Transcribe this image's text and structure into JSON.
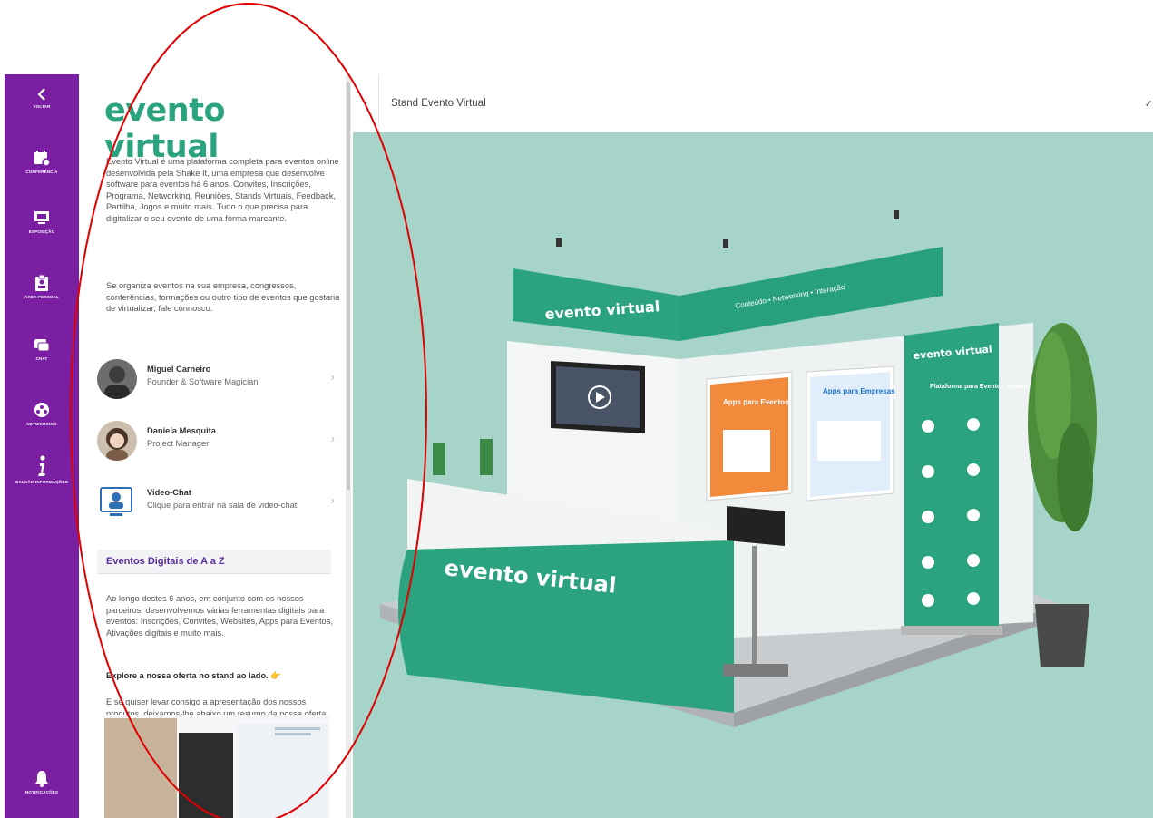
{
  "rail": {
    "items": [
      {
        "label": "VOLTAR",
        "icon": "chevron-left-icon"
      },
      {
        "label": "CONFERÊNCIA",
        "icon": "calendar-icon"
      },
      {
        "label": "EXPOSIÇÃO",
        "icon": "presentation-icon"
      },
      {
        "label": "ÁREA PESSOAL",
        "icon": "badge-icon"
      },
      {
        "label": "CHAT",
        "icon": "chat-icon"
      },
      {
        "label": "NETWORKING",
        "icon": "network-icon"
      },
      {
        "label": "BALCÃO INFORMAÇÕES",
        "icon": "info-icon"
      },
      {
        "label": "NOTIFICAÇÕES",
        "icon": "bell-icon"
      }
    ]
  },
  "panel": {
    "logo": "evento virtual",
    "intro": "Evento Virtual é uma plataforma completa para eventos online desenvolvida pela Shake It, uma empresa que desenvolve software para eventos há 6 anos. Convites, Inscrições, Programa, Networking, Reuniões, Stands Virtuais, Feedback, Partilha, Jogos e muito mais. Tudo o que precisa para digitalizar o seu evento de uma forma marcante.",
    "intro2": "Se organiza eventos na sua empresa, congressos, conferências, formações ou outro tipo de eventos que gostaria de virtualizar, fale connosco.",
    "contacts": [
      {
        "name": "Miguel Carneiro",
        "role": "Founder & Software Magician"
      },
      {
        "name": "Daniela Mesquita",
        "role": "Project Manager"
      },
      {
        "name": "Video-Chat",
        "role": "Clique para entrar na sala de video-chat"
      }
    ],
    "section_title": "Eventos Digitais de A a Z",
    "body": "Ao longo destes 6 anos, em conjunto com os nossos parceiros, desenvolvemos várias ferramentas digitais para eventos: Inscrições, Convites, Websites, Apps para Eventos, Ativações digitais e muito mais.",
    "explore": "Explore a nossa oferta no stand ao lado. 👉",
    "closing": "E se quiser levar consigo a apresentação dos nossos produtos, deixamos-lhe abaixo um resumo da nossa oferta, que pode enviar para o seu e-mail."
  },
  "stage": {
    "title": "Stand Evento Virtual",
    "back": "‹",
    "check": "✓",
    "booth_logo": "evento virtual",
    "booth_tagline": "Conteúdo • Networking • Interação",
    "poster1": "Apps para Eventos",
    "poster2": "Apps para Empresas",
    "banner_logo": "evento virtual",
    "banner_title": "Plataforma para Eventos Virtuais",
    "counter_logo": "evento virtual"
  },
  "colors": {
    "rail": "#7a1fa2",
    "brand_green": "#2aa37e",
    "stage_bg": "#a6d4c9",
    "section_title": "#5a2d9c",
    "annotation": "#e00000"
  }
}
